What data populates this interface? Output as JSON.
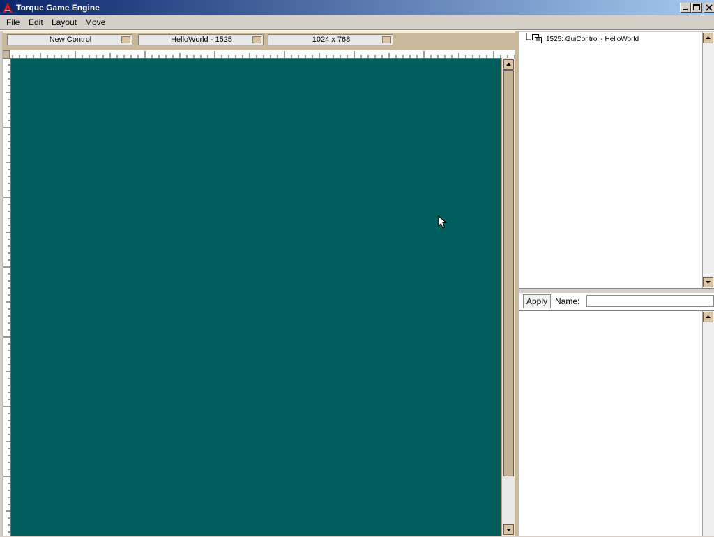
{
  "window": {
    "title": "Torque Game Engine",
    "icon": "torque-logo-icon",
    "controls": [
      "minimize-icon",
      "maximize-icon",
      "close-icon"
    ]
  },
  "menu": {
    "items": [
      {
        "label": "File"
      },
      {
        "label": "Edit"
      },
      {
        "label": "Layout"
      },
      {
        "label": "Move"
      }
    ]
  },
  "toolbar": {
    "new_control": "New Control",
    "current_gui": "HelloWorld - 1525",
    "resolution": "1024 x 768"
  },
  "canvas": {
    "background_color": "#005e5c"
  },
  "tree": {
    "items": [
      {
        "label": "1525: GuiControl - HelloWorld",
        "icon": "gui-control-icon"
      }
    ]
  },
  "inspector": {
    "apply_label": "Apply",
    "name_label": "Name:",
    "name_value": ""
  },
  "colors": {
    "accent": "#c9b89a",
    "titlebar_start": "#0a246a",
    "titlebar_end": "#a6caf0"
  }
}
